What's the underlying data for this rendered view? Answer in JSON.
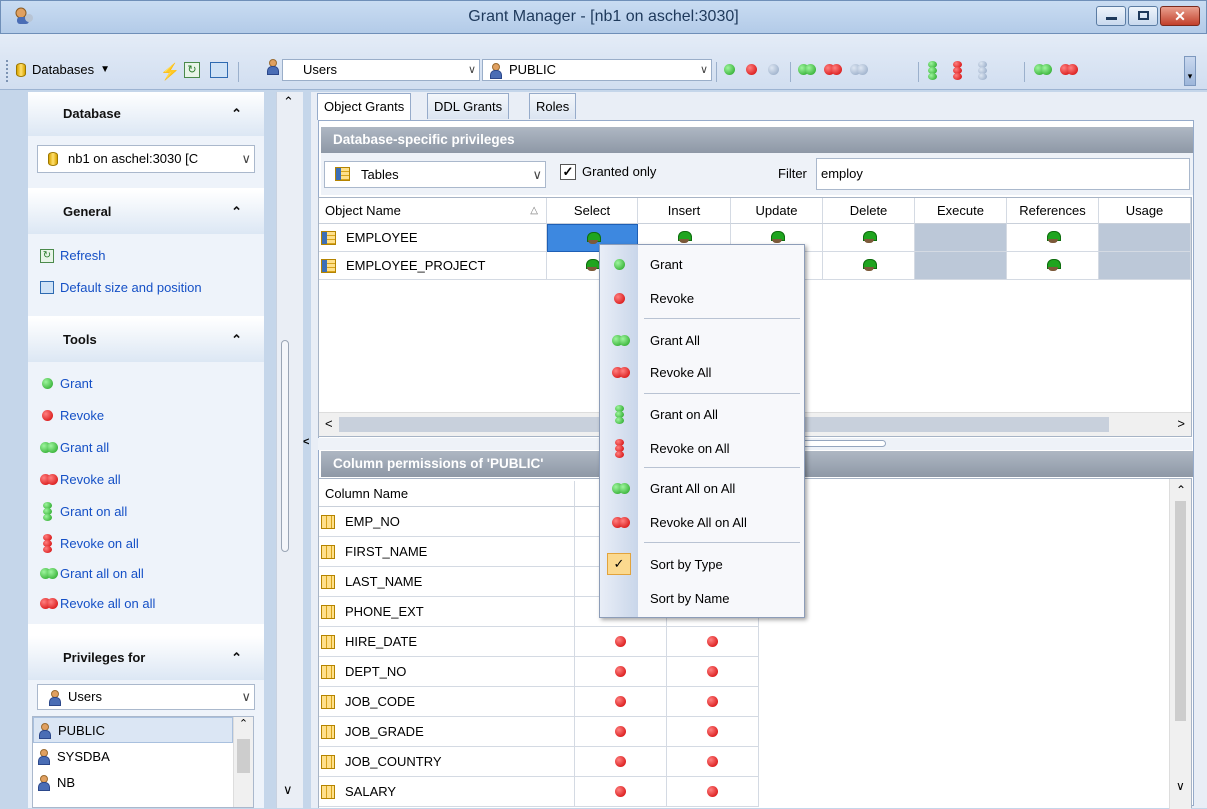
{
  "window": {
    "title": "Grant Manager - [nb1 on aschel:3030]"
  },
  "toolbar": {
    "databases_label": "Databases",
    "users_combo": "Users",
    "grantee_combo": "PUBLIC"
  },
  "sidebar": {
    "database": {
      "title": "Database",
      "selected": "nb1 on aschel:3030 [C"
    },
    "general": {
      "title": "General",
      "items": [
        {
          "label": "Refresh"
        },
        {
          "label": "Default size and position"
        }
      ]
    },
    "tools": {
      "title": "Tools",
      "items": [
        {
          "label": "Grant"
        },
        {
          "label": "Revoke"
        },
        {
          "label": "Grant all"
        },
        {
          "label": "Revoke all"
        },
        {
          "label": "Grant on all"
        },
        {
          "label": "Revoke on all"
        },
        {
          "label": "Grant all on all"
        },
        {
          "label": "Revoke all on all"
        }
      ]
    },
    "privileges_for": {
      "title": "Privileges for",
      "type": "Users",
      "list": [
        "PUBLIC",
        "SYSDBA",
        "NB"
      ]
    }
  },
  "tabs": [
    "Object Grants",
    "DDL Grants",
    "Roles"
  ],
  "db_privileges": {
    "title": "Database-specific privileges",
    "object_type": "Tables",
    "granted_only_label": "Granted only",
    "filter_label": "Filter",
    "filter_value": "employ",
    "columns": [
      "Object Name",
      "Select",
      "Insert",
      "Update",
      "Delete",
      "Execute",
      "References",
      "Usage"
    ],
    "rows": [
      {
        "name": "EMPLOYEE"
      },
      {
        "name": "EMPLOYEE_PROJECT"
      }
    ]
  },
  "column_permissions": {
    "title": "Column permissions of 'PUBLIC'",
    "header": "Column Name",
    "rows": [
      "EMP_NO",
      "FIRST_NAME",
      "LAST_NAME",
      "PHONE_EXT",
      "HIRE_DATE",
      "DEPT_NO",
      "JOB_CODE",
      "JOB_GRADE",
      "JOB_COUNTRY",
      "SALARY"
    ]
  },
  "context_menu": [
    "Grant",
    "Revoke",
    "Grant All",
    "Revoke All",
    "Grant on All",
    "Revoke on All",
    "Grant All on All",
    "Revoke All on All",
    "Sort by Type",
    "Sort by Name"
  ],
  "colors": {
    "grant": "#1ca01c",
    "revoke": "#d00000",
    "accent": "#1550c6"
  }
}
